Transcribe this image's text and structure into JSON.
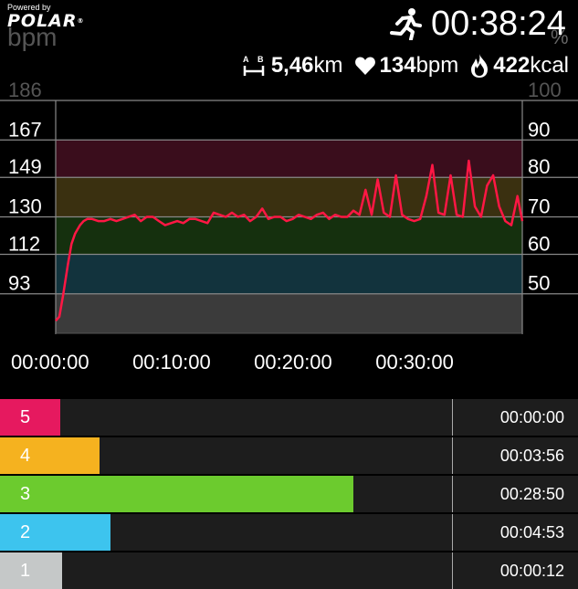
{
  "header": {
    "powered_by": "Powered by",
    "brand": "POLAR",
    "brand_mark": "®",
    "left_unit": "bpm",
    "right_unit": "%",
    "sport_icon": "running-icon",
    "duration": "00:38:24"
  },
  "stats": {
    "distance_icon": "distance-icon",
    "distance_value": "5,46",
    "distance_unit": "km",
    "hr_icon": "heart-icon",
    "hr_value": "134",
    "hr_unit": "bpm",
    "cal_icon": "flame-icon",
    "cal_value": "422",
    "cal_unit": "kcal"
  },
  "chart_data": {
    "type": "line",
    "y_left_ticks": [
      "186",
      "167",
      "149",
      "130",
      "112",
      "93"
    ],
    "y_right_ticks": [
      "100",
      "90",
      "80",
      "70",
      "60",
      "50"
    ],
    "x_ticks": [
      "00:00:00",
      "00:10:00",
      "00:20:00",
      "00:30:00"
    ],
    "ylim": [
      74,
      186
    ],
    "xlim": [
      0,
      38.4
    ],
    "line_color": "#ff1744",
    "zone_colors": [
      "#3a0d1c",
      "#3a3010",
      "#15300e",
      "#12333d",
      "#3b3b3b"
    ],
    "series": [
      {
        "x": [
          0,
          0.3,
          0.6,
          1.0,
          1.3,
          1.6,
          2.0,
          2.3,
          2.6,
          3.0,
          3.5,
          4,
          4.5,
          5,
          5.5,
          6,
          6.5,
          7,
          7.5,
          8,
          8.5,
          9,
          9.5,
          10,
          10.5,
          11,
          11.5,
          12,
          12.5,
          13,
          13.5,
          14,
          14.5,
          15,
          15.5,
          16,
          16.5,
          17,
          17.5,
          18,
          18.5,
          19,
          19.5,
          20,
          20.5,
          21,
          21.5,
          22,
          22.5,
          23,
          23.5,
          24,
          24.5,
          25,
          25.5,
          26,
          26.5,
          27,
          27.5,
          28,
          28.5,
          29,
          29.5,
          30,
          30.5,
          31,
          31.5,
          32,
          32.5,
          33,
          33.5,
          34,
          34.5,
          35,
          35.5,
          36,
          36.5,
          37,
          37.5,
          38,
          38.4
        ],
        "y": [
          80,
          82,
          92,
          107,
          117,
          122,
          126,
          128,
          129,
          129,
          128,
          128,
          129,
          128,
          129,
          130,
          131,
          128,
          130,
          130,
          128,
          126,
          127,
          128,
          127,
          129,
          129,
          128,
          127,
          132,
          131,
          130,
          132,
          130,
          131,
          128,
          130,
          134,
          129,
          130,
          130,
          128,
          129,
          131,
          130,
          129,
          131,
          132,
          129,
          131,
          130,
          130,
          133,
          131,
          143,
          131,
          148,
          132,
          130,
          150,
          131,
          129,
          128,
          129,
          140,
          155,
          132,
          131,
          150,
          131,
          130,
          157,
          135,
          130,
          145,
          150,
          135,
          128,
          126,
          140,
          128
        ]
      }
    ]
  },
  "zones": [
    {
      "num": "5",
      "color": "#e6195f",
      "frac": 0.0,
      "time": "00:00:00"
    },
    {
      "num": "4",
      "color": "#f5b21f",
      "frac": 0.101,
      "time": "00:03:56"
    },
    {
      "num": "3",
      "color": "#6ccb2e",
      "frac": 0.748,
      "time": "00:28:50"
    },
    {
      "num": "2",
      "color": "#3dc4ee",
      "frac": 0.128,
      "time": "00:04:53"
    },
    {
      "num": "1",
      "color": "#c5c8c8",
      "frac": 0.005,
      "time": "00:00:12"
    }
  ]
}
